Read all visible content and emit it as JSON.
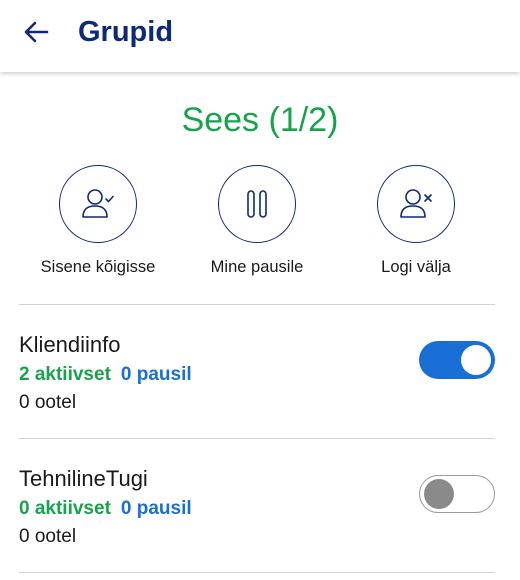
{
  "header": {
    "title": "Grupid",
    "back_icon": "arrow-left-icon"
  },
  "status": {
    "text": "Sees (1/2)",
    "color": "#16a34a"
  },
  "actions": [
    {
      "label": "Sisene kõigisse",
      "icon": "user-check-icon"
    },
    {
      "label": "Mine pausile",
      "icon": "pause-icon"
    },
    {
      "label": "Logi välja",
      "icon": "user-x-icon"
    }
  ],
  "groups": [
    {
      "name": "Kliendiinfo",
      "active": "2 aktiivset",
      "paused": "0 pausil",
      "waiting": "0 ootel",
      "enabled": true
    },
    {
      "name": "TehnilineTugi",
      "active": "0 aktiivset",
      "paused": "0 pausil",
      "waiting": "0 ootel",
      "enabled": false
    }
  ],
  "colors": {
    "brand": "#0d2a7a",
    "active": "#16a34a",
    "paused": "#1a6fd6",
    "toggle_on": "#1a6fd6"
  }
}
